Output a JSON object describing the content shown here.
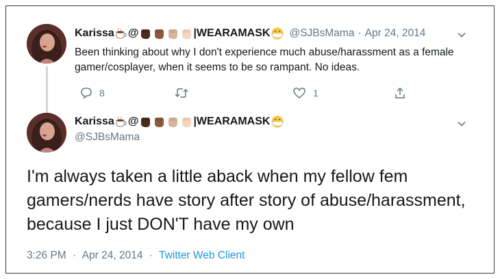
{
  "colors": {
    "text": "#14171a",
    "secondary": "#657786",
    "link": "#1b95e0",
    "thread_line": "#cfd9de",
    "frame_border": "#3a3a3a"
  },
  "tweet1": {
    "display_name": "Karissa",
    "name_suffix": "@",
    "name_tag": "|WEARAMASK",
    "handle": "@SJBsMama",
    "separator": "·",
    "date": "Apr 24, 2014",
    "text": "Been thinking about why I don't experience much abuse/harassment as a female gamer/cosplayer, when it seems to be so rampant. No ideas.",
    "actions": {
      "reply_count": "8",
      "retweet_count": "",
      "like_count": "1"
    },
    "icons": [
      "reply-icon",
      "retweet-icon",
      "like-icon",
      "share-icon",
      "chevron-down-icon"
    ]
  },
  "tweet2": {
    "display_name": "Karissa",
    "name_suffix": "@",
    "name_tag": "|WEARAMASK",
    "handle": "@SJBsMama",
    "text": "I'm always taken a little aback when my fellow fem gamers/nerds have story after story of abuse/harassment, because I just DON'T have my own",
    "time": "3:26 PM",
    "separator": "·",
    "date": "Apr 24, 2014",
    "client": "Twitter Web Client"
  },
  "name_emojis": [
    "hot-beverage-emoji",
    "raised-fist-dark-emoji",
    "raised-fist-medium-dark-emoji",
    "raised-fist-medium-light-emoji",
    "raised-fist-light-emoji",
    "medical-mask-emoji"
  ]
}
